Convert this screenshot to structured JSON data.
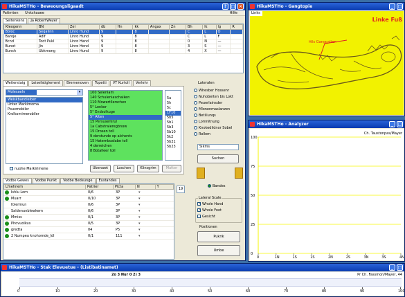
{
  "colors": {
    "title_bg": "#0a3bb0",
    "workspace": "#3a6ea5",
    "green_list": "#55e055",
    "chart_grid": "#f6f600",
    "dot": "#1a8f1a"
  },
  "main": {
    "title": "HikaMSTHo - Beweoungsligaadt",
    "menu": [
      "Patirnten",
      "Unkshaaee"
    ],
    "menu_right": "Hilfe",
    "tabs_top": [
      "Seitenkens",
      "Ja RobertWeyer"
    ],
    "top_columns": [
      "Kleogenn",
      "BN",
      "Zei",
      "db",
      "Hn",
      "kk",
      "Angax",
      "Zn",
      "Bh",
      "lk",
      "lg",
      "R"
    ],
    "top_rows": [
      {
        "a": "Bbloc",
        "b": "Seqalinn",
        "c": "Linro Hund",
        "d": "9",
        "e": "8",
        "f": "C",
        "g": "L",
        "h": "O"
      },
      {
        "a": "Baroje",
        "b": "Adlf",
        "c": "Linro Hund",
        "d": "9",
        "e": "8",
        "f": "C",
        "g": "L",
        "h": "F"
      },
      {
        "a": "Bcnd",
        "b": "Toot Pukl",
        "c": "Linro Hand",
        "d": "9",
        "e": "8",
        "f": "0",
        "g": "N",
        "h": "—"
      },
      {
        "a": "Bunot",
        "b": "Jin",
        "c": "Linro Hond",
        "d": "9",
        "e": "8",
        "f": "3",
        "g": "S",
        "h": "—"
      },
      {
        "a": "Bunsh",
        "b": "Ubkmong",
        "c": "Linro Hund",
        "d": "9",
        "e": "8",
        "f": "4",
        "g": "X",
        "h": "—"
      }
    ],
    "mid_tabs": [
      "Weiterstaig",
      "Leisefatiglement",
      "Bremenoven",
      "Topetti",
      "VT Kurtoll",
      "Verlehr"
    ],
    "combo_value": "Molesaeln",
    "left_list": [
      "Weiskbandleiber",
      "Unter Markimoma",
      "Pouxmobiler",
      "Krolkomimerobiler"
    ],
    "green_items": [
      "100 Selenlam",
      "140 Schuleniaschaiken",
      "110 Mowertllerschen",
      "5° Lenkor",
      "5° Endsolkuge",
      "5° Alten",
      "15 Persuserkrul",
      "1a Cabstraieregbnow",
      "15 Drosen toll",
      "9 derstunde op alchents",
      "15 Haternboalabe toll",
      "4 derreichen",
      "8 Botalleer toll"
    ],
    "small_list": [
      "5a",
      "5h",
      "5c",
      "1F10",
      "5b5",
      "5b1",
      "5b3",
      "5b10",
      "5k2",
      "5b21",
      "5b23"
    ],
    "checkbox_left": "nuohe Markirimene",
    "btn_uebernat": "Ubenawt",
    "btn_loeschen": "Loschen",
    "btn_klinsgrim": "Klinsgrim",
    "btn_mutter": "Matter",
    "lateral_title": "Lateralen",
    "lateral_opts": [
      "Whesber Hossenr",
      "Nuhobeiten bis Lokt",
      "Peuerlainsder",
      "Mlonenmaslanzen",
      "Betiliunqs",
      "Lomnitnung",
      "Knokedildnor Sobel",
      "Rollem"
    ],
    "lateral_input": "Sikms",
    "btn_suchen": "Suchen",
    "bottom_tabs": [
      "Vodbe Gewes",
      "Vodbe Punkt",
      "Vodbe Bedeunge",
      "Eustandes"
    ],
    "bottom_columns": [
      "Lfnehnem",
      "Patrier",
      "Plcta",
      "N",
      "Y"
    ],
    "bottom_rows": [
      {
        "name": "Ishlu Lorn",
        "v1": "0/6",
        "v2": "3P",
        "dot": true
      },
      {
        "name": "Muarr",
        "v1": "0/10",
        "v2": "3P",
        "dot": true
      },
      {
        "name": "folermun",
        "v1": "0/6",
        "v2": "3P",
        "dot": false
      },
      {
        "name": "Saldenunblewkern",
        "v1": "0/6",
        "v2": "3P",
        "dot": false
      },
      {
        "name": "Mmiss",
        "v1": "0/1",
        "v2": "3P",
        "dot": true
      },
      {
        "name": "Phovuolkus",
        "v1": "0/5",
        "v2": "3P",
        "dot": true
      },
      {
        "name": "gredta",
        "v1": "04",
        "v2": "P5",
        "dot": true
      },
      {
        "name": "2 Numpeu knohomde_ldl",
        "v1": "0/1",
        "v2": "111",
        "dot": true
      }
    ],
    "spin_value": "19",
    "folder_label": "Bandes",
    "lateral_scale_title": "Lateral Scale",
    "scale_opts": [
      "Whole Hand",
      "Whole Foot",
      "Gesicht"
    ],
    "position_title": "Positionen",
    "btn_pukrik": "Pukrik",
    "btn_umbe": "Umbe"
  },
  "foot": {
    "title": "HikaMSTHo - Gangtopie",
    "label_top": "Linke Fuß",
    "label_mid": "Hils Gangpalten"
  },
  "chart": {
    "title": "HikaMSTHo - Analyzer",
    "legend": "Ch. Taustonpas/Mayer",
    "y_ticks": [
      "100",
      "75",
      "50",
      "25",
      "0"
    ],
    "x_ticks": [
      "0",
      "1N",
      "1S",
      "1S",
      "2N",
      "2S",
      "3N",
      "3S",
      "4N"
    ]
  },
  "chart_data": {
    "type": "line",
    "title": "",
    "xlabel": "",
    "ylabel": "",
    "ylim": [
      0,
      100
    ],
    "series": [
      {
        "name": "Ch. Taustonpas/Mayer",
        "values": []
      }
    ]
  },
  "timeline": {
    "title": "HikaMSTHo - Stak Elevuetue - (Listibatinamet)",
    "center_text": "2o 3 Nur 0 2) 3",
    "right_text": "Pr Ch. Fassmon/Mayer, 44",
    "ticks": [
      "0",
      "10",
      "20",
      "30",
      "40",
      "50",
      "60",
      "70",
      "80",
      "90",
      "100"
    ]
  }
}
